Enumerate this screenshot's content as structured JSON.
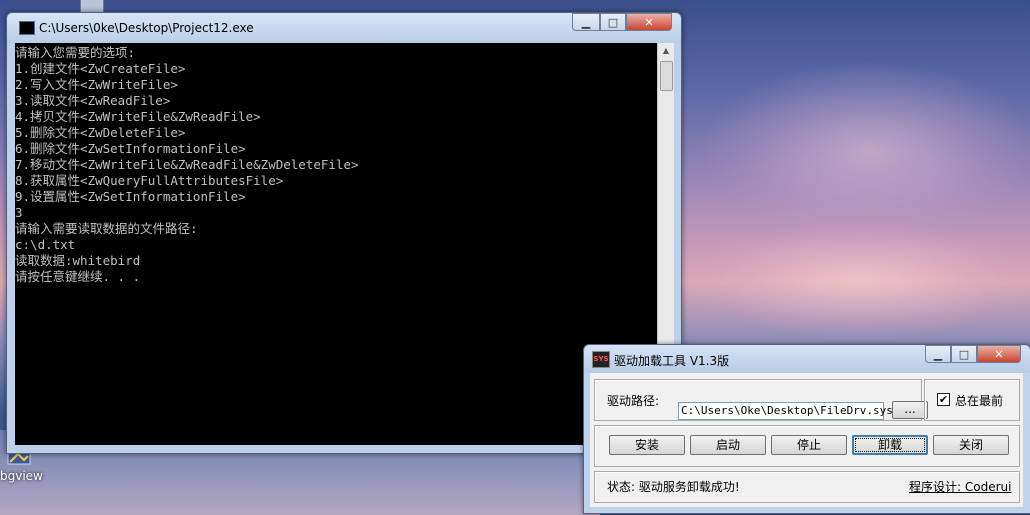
{
  "desktop": {
    "icon_label": "bgview"
  },
  "console": {
    "title": "C:\\Users\\0ke\\Desktop\\Project12.exe",
    "buttons": {
      "minimize": "▁",
      "maximize": "□",
      "close": "✕"
    },
    "scroll_up": "▲",
    "lines": [
      "请输入您需要的选项:",
      "1.创建文件<ZwCreateFile>",
      "2.写入文件<ZwWriteFile>",
      "3.读取文件<ZwReadFile>",
      "4.拷贝文件<ZwWriteFile&ZwReadFile>",
      "5.删除文件<ZwDeleteFile>",
      "6.删除文件<ZwSetInformationFile>",
      "7.移动文件<ZwWriteFile&ZwReadFile&ZwDeleteFile>",
      "8.获取属性<ZwQueryFullAttributesFile>",
      "9.设置属性<ZwSetInformationFile>",
      "3",
      "请输入需要读取数据的文件路径:",
      "c:\\d.txt",
      "读取数据:whitebird",
      "请按任意键继续. . ."
    ]
  },
  "tool": {
    "icon_text": "SYS",
    "title": "驱动加载工具 V1.3版",
    "buttons": {
      "minimize": "▁",
      "maximize": "□",
      "close": "✕"
    },
    "path_label": "驱动路径:",
    "path_value": "C:\\Users\\Oke\\Desktop\\FileDrv.sys",
    "browse_label": "...",
    "topmost_label": "总在最前",
    "topmost_checked": "✔",
    "actions": [
      "安装",
      "启动",
      "停止",
      "卸载",
      "关闭"
    ],
    "status_text": "状态: 驱动服务卸载成功!",
    "credit": "程序设计: Coderui"
  }
}
